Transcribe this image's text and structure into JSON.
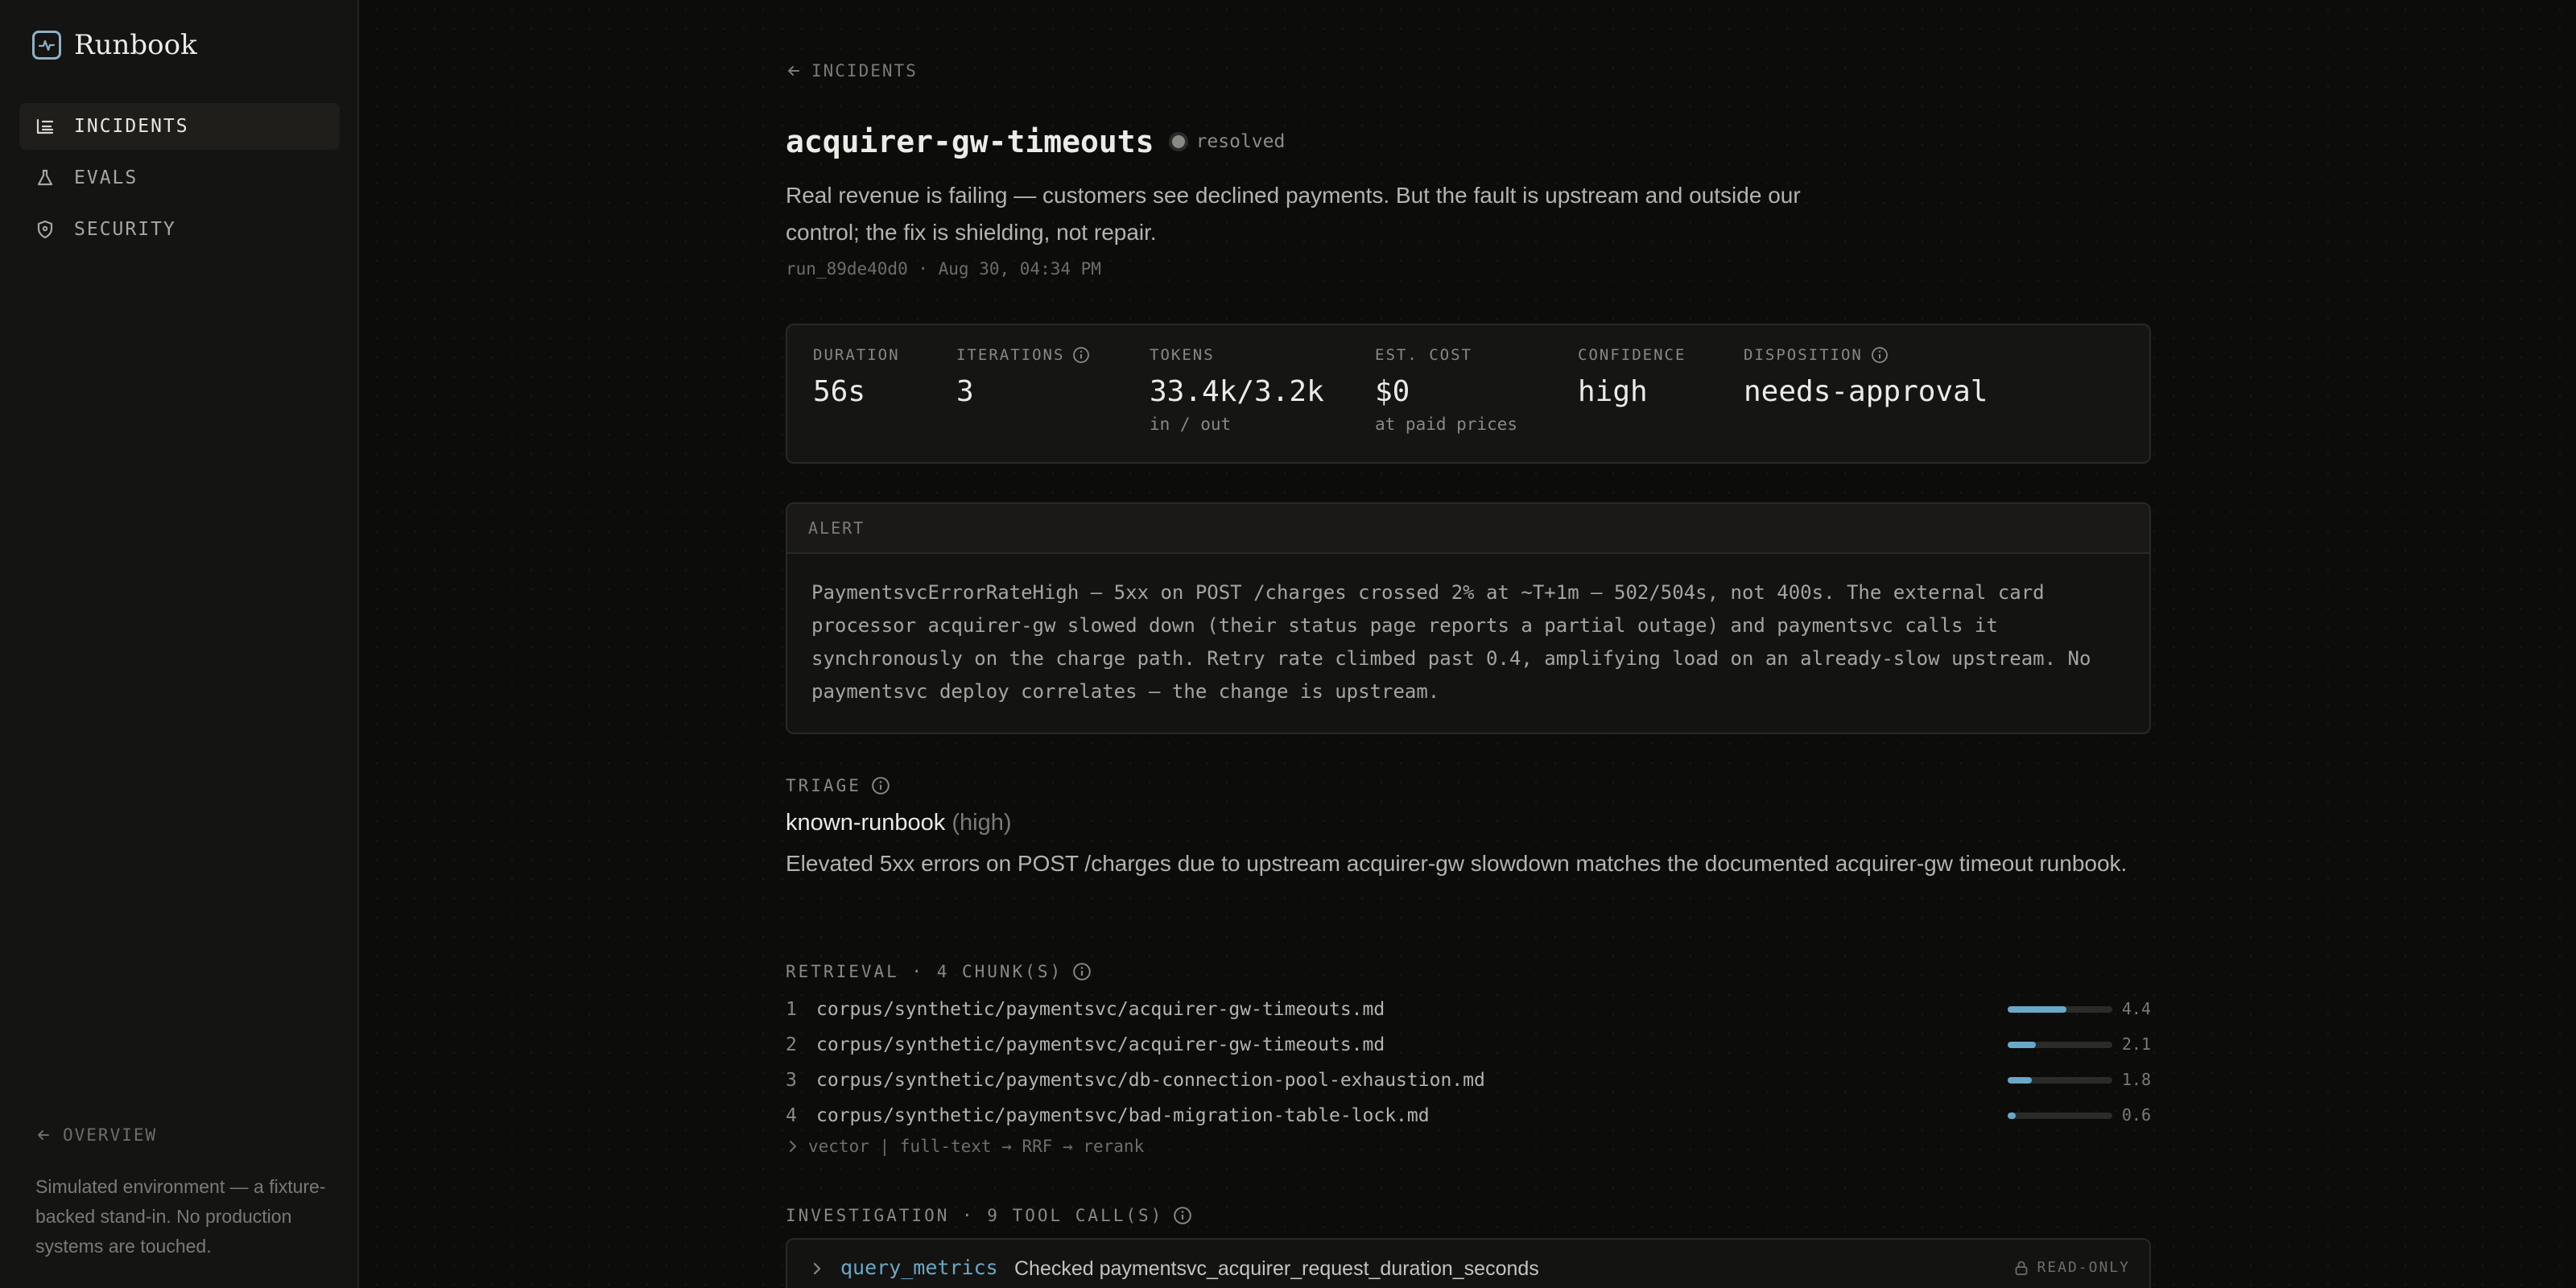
{
  "sidebar": {
    "brand": "Runbook",
    "nav": [
      {
        "label": "INCIDENTS",
        "active": true
      },
      {
        "label": "EVALS",
        "active": false
      },
      {
        "label": "SECURITY",
        "active": false
      }
    ],
    "overview_label": "OVERVIEW",
    "disclaimer": "Simulated environment — a fixture-backed stand-in. No production systems are touched."
  },
  "header": {
    "back_label": "INCIDENTS",
    "title": "acquirer-gw-timeouts",
    "status": "resolved",
    "summary": "Real revenue is failing — customers see declined payments. But the fault is upstream and outside our control; the fix is shielding, not repair.",
    "meta": "run_89de40d0 · Aug 30, 04:34 PM"
  },
  "stats": [
    {
      "label": "DURATION",
      "value": "56s",
      "sub": "",
      "info": false
    },
    {
      "label": "ITERATIONS",
      "value": "3",
      "sub": "",
      "info": true
    },
    {
      "label": "TOKENS",
      "value": "33.4k/3.2k",
      "sub": "in / out",
      "info": false
    },
    {
      "label": "EST. COST",
      "value": "$0",
      "sub": "at paid prices",
      "info": false
    },
    {
      "label": "CONFIDENCE",
      "value": "high",
      "sub": "",
      "info": false
    },
    {
      "label": "DISPOSITION",
      "value": "needs-approval",
      "sub": "",
      "info": true
    }
  ],
  "alert": {
    "header": "ALERT",
    "body": "PaymentsvcErrorRateHigh — 5xx on POST /charges crossed 2% at ~T+1m — 502/504s, not 400s. The external card processor acquirer-gw slowed down (their status page reports a partial outage) and paymentsvc calls it synchronously on the charge path. Retry rate climbed past 0.4, amplifying load on an already-slow upstream. No paymentsvc deploy correlates — the change is upstream."
  },
  "triage": {
    "label": "TRIAGE",
    "type": "known-runbook",
    "confidence": "(high)",
    "text": "Elevated 5xx errors on POST /charges due to upstream acquirer-gw slowdown matches the documented acquirer-gw timeout runbook."
  },
  "retrieval": {
    "label": "RETRIEVAL · 4 CHUNK(S)",
    "chunks": [
      {
        "num": "1",
        "path": "corpus/synthetic/paymentsvc/acquirer-gw-timeouts.md",
        "score": "4.4",
        "fill": 0.56
      },
      {
        "num": "2",
        "path": "corpus/synthetic/paymentsvc/acquirer-gw-timeouts.md",
        "score": "2.1",
        "fill": 0.27
      },
      {
        "num": "3",
        "path": "corpus/synthetic/paymentsvc/db-connection-pool-exhaustion.md",
        "score": "1.8",
        "fill": 0.23
      },
      {
        "num": "4",
        "path": "corpus/synthetic/paymentsvc/bad-migration-table-lock.md",
        "score": "0.6",
        "fill": 0.08
      }
    ],
    "pipeline": "vector ∣ full-text → RRF → rerank"
  },
  "investigation": {
    "label": "INVESTIGATION · 9 TOOL CALL(S)",
    "tool_name": "query_metrics",
    "tool_desc": "Checked paymentsvc_acquirer_request_duration_seconds",
    "badge": "READ-ONLY"
  },
  "colors": {
    "accent": "#6aa8c8",
    "background": "#0c0c0b",
    "sidebar": "#141412"
  }
}
